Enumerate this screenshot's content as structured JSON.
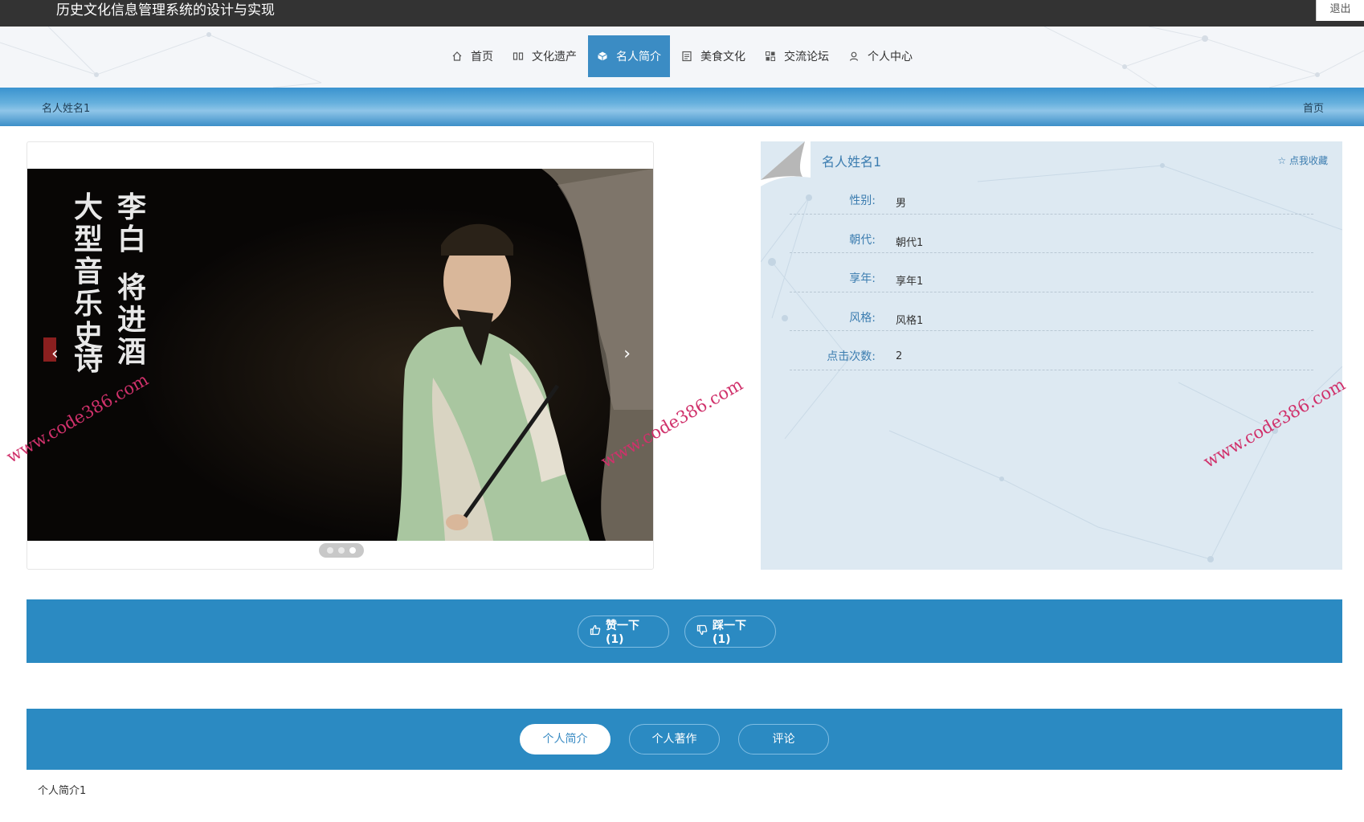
{
  "header": {
    "site_title": "历史文化信息管理系统的设计与实现",
    "logout_label": "退出"
  },
  "nav": {
    "items": [
      {
        "label": "首页",
        "icon": "home-icon"
      },
      {
        "label": "文化遗产",
        "icon": "columns-icon"
      },
      {
        "label": "名人简介",
        "icon": "cube-icon",
        "active": true
      },
      {
        "label": "美食文化",
        "icon": "document-icon"
      },
      {
        "label": "交流论坛",
        "icon": "grid-icon"
      },
      {
        "label": "个人中心",
        "icon": "user-icon"
      }
    ]
  },
  "breadcrumb": {
    "current": "名人姓名1",
    "home_link": "首页"
  },
  "carousel": {
    "prev_label": "‹",
    "next_label": "›",
    "slide_count": 3,
    "active_slide": 3,
    "poster_text_line1": "李白 将进酒",
    "poster_text_line2": "大型音乐史诗"
  },
  "profile": {
    "name": "名人姓名1",
    "favorite_label": "点我收藏",
    "fields": [
      {
        "label": "性别:",
        "value": "男"
      },
      {
        "label": "朝代:",
        "value": "朝代1"
      },
      {
        "label": "享年:",
        "value": "享年1"
      },
      {
        "label": "风格:",
        "value": "风格1"
      },
      {
        "label": "点击次数:",
        "value": "2"
      }
    ]
  },
  "votes": {
    "like_label": "赞一下(1)",
    "dislike_label": "踩一下(1)"
  },
  "tabs": {
    "items": [
      "个人简介",
      "个人著作",
      "评论"
    ],
    "active_index": 0,
    "content": "个人简介1"
  },
  "watermark": {
    "text": "www.code386.com"
  },
  "colors": {
    "primary": "#2b8ac2",
    "nav_active": "#3b8cc4",
    "topbar": "#333333",
    "label_blue": "#3c7db0",
    "info_bg": "#dde9f2"
  }
}
